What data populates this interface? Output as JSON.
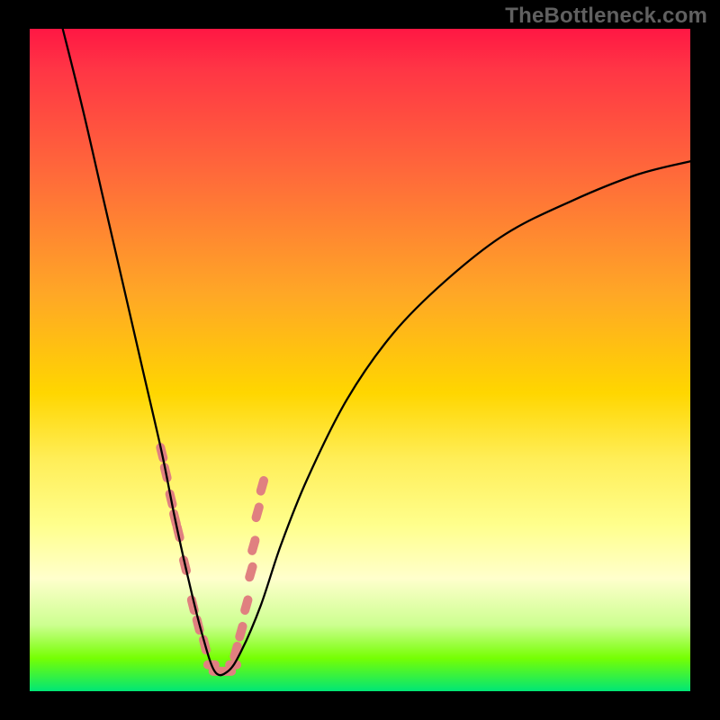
{
  "watermark_text": "TheBottleneck.com",
  "colors": {
    "gradient_top": "#ff1744",
    "gradient_mid_orange": "#ffa726",
    "gradient_mid_yellow": "#ffd600",
    "gradient_bottom": "#00e676",
    "background": "#000000",
    "curve": "#000000",
    "dots": "#e08080",
    "watermark": "#606060"
  },
  "chart_data": {
    "type": "line",
    "title": "",
    "xlabel": "",
    "ylabel": "",
    "xlim": [
      0,
      100
    ],
    "ylim": [
      0,
      100
    ],
    "grid": false,
    "legend": false,
    "note": "x/y are percentage coordinates inside the plot area; y=0 is the bottom (green) edge, y=100 is the top (red) edge. The curve dips to a minimum near x≈28 and rises asymmetrically on either side.",
    "series": [
      {
        "name": "bottleneck-curve",
        "x": [
          5,
          8,
          11,
          14,
          17,
          20,
          22,
          24,
          26,
          28,
          30,
          32,
          35,
          38,
          42,
          48,
          55,
          63,
          72,
          82,
          92,
          100
        ],
        "y": [
          100,
          88,
          75,
          62,
          49,
          36,
          26,
          17,
          9,
          3,
          3,
          6,
          13,
          22,
          32,
          44,
          54,
          62,
          69,
          74,
          78,
          80
        ]
      }
    ],
    "highlight_points": {
      "name": "dot-cluster",
      "note": "Pink capsule-like dots clustered around the curve's minimum region, roughly x∈[20,35].",
      "x": [
        20.0,
        20.6,
        21.4,
        22.0,
        22.5,
        23.5,
        24.7,
        25.5,
        26.5,
        27.5,
        28.3,
        29.0,
        30.0,
        30.8,
        31.2,
        32.0,
        32.8,
        33.5,
        33.9,
        34.5,
        35.2
      ],
      "y": [
        36,
        33,
        29,
        26,
        24,
        19,
        13,
        10,
        7,
        4,
        3,
        3,
        3,
        4,
        6,
        9,
        13,
        18,
        22,
        27,
        31
      ]
    }
  }
}
